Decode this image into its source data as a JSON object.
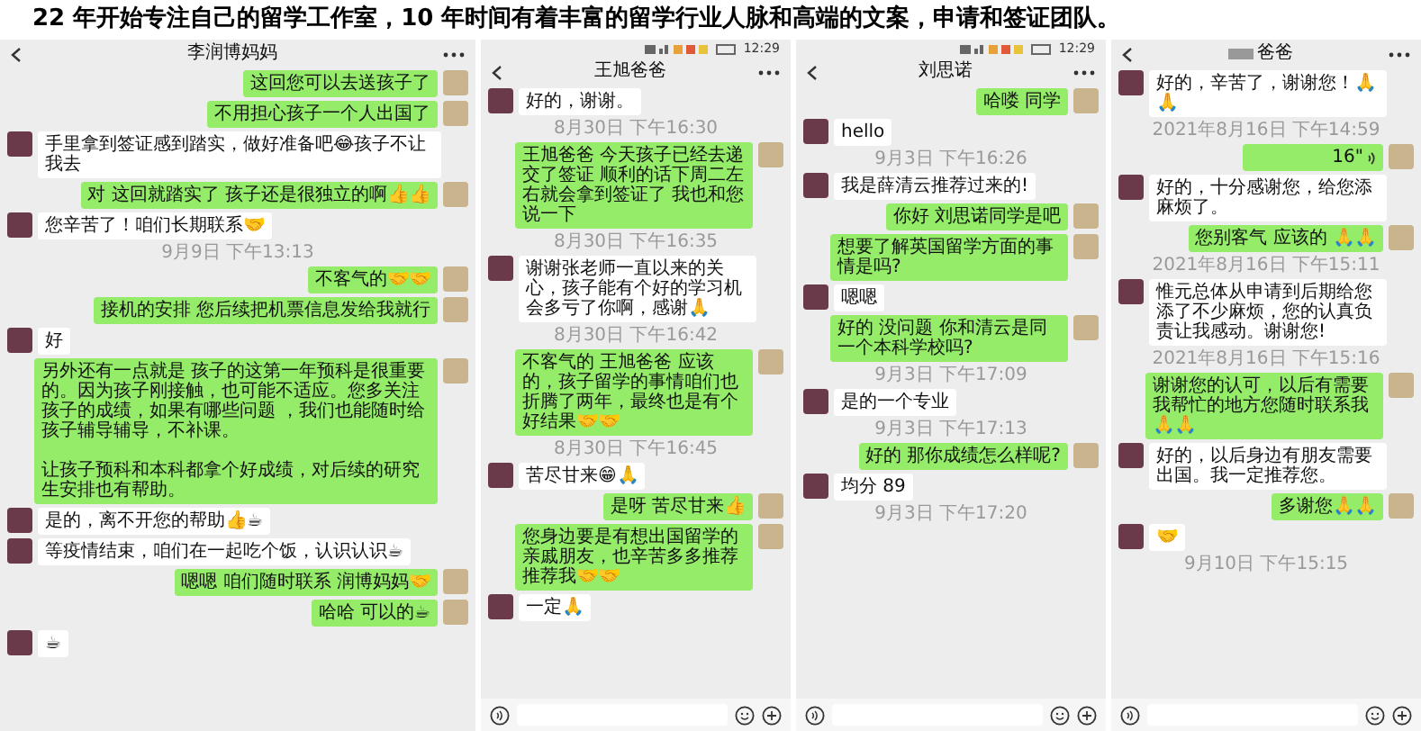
{
  "heading": "22 年开始专注自己的留学工作室，10 年时间有着丰富的留学行业人脉和高端的文案，申请和签证团队。",
  "chats": [
    {
      "title": "李润博妈妈",
      "input_bar": false,
      "messages": [
        {
          "kind": "text",
          "sent": true,
          "text": "这回您可以去送孩子了"
        },
        {
          "kind": "text",
          "sent": true,
          "text": "不用担心孩子一个人出国了"
        },
        {
          "kind": "text",
          "sent": false,
          "text": "手里拿到签证感到踏实，做好准备吧😂孩子不让我去"
        },
        {
          "kind": "text",
          "sent": true,
          "text": "对 这回就踏实了 孩子还是很独立的啊👍👍"
        },
        {
          "kind": "text",
          "sent": false,
          "text": "您辛苦了！咱们长期联系🤝"
        },
        {
          "kind": "time",
          "text": "9月9日 下午13:13"
        },
        {
          "kind": "text",
          "sent": true,
          "text": "不客气的🤝🤝"
        },
        {
          "kind": "text",
          "sent": true,
          "text": "接机的安排 您后续把机票信息发给我就行"
        },
        {
          "kind": "text",
          "sent": false,
          "text": "好"
        },
        {
          "kind": "text",
          "sent": true,
          "paragraphs": [
            "另外还有一点就是 孩子的这第一年预科是很重要的。因为孩子刚接触，也可能不适应。您多关注孩子的成绩，如果有哪些问题 ，我们也能随时给孩子辅导辅导，不补课。",
            "让孩子预科和本科都拿个好成绩，对后续的研究生安排也有帮助。"
          ]
        },
        {
          "kind": "text",
          "sent": false,
          "text": "是的，离不开您的帮助👍☕"
        },
        {
          "kind": "text",
          "sent": false,
          "text": "等疫情结束，咱们在一起吃个饭，认识认识☕"
        },
        {
          "kind": "text",
          "sent": true,
          "text": "嗯嗯 咱们随时联系 润博妈妈🤝"
        },
        {
          "kind": "text",
          "sent": true,
          "text": "哈哈 可以的☕"
        },
        {
          "kind": "text",
          "sent": false,
          "text": "☕"
        }
      ]
    },
    {
      "title": "王旭爸爸",
      "status_time": "12:29",
      "input_bar": true,
      "messages": [
        {
          "kind": "text",
          "sent": false,
          "text": "好的，谢谢。"
        },
        {
          "kind": "time",
          "text": "8月30日 下午16:30"
        },
        {
          "kind": "text",
          "sent": true,
          "text": "王旭爸爸 今天孩子已经去递交了签证 顺利的话下周二左右就会拿到签证了 我也和您说一下"
        },
        {
          "kind": "time",
          "text": "8月30日 下午16:35"
        },
        {
          "kind": "text",
          "sent": false,
          "text": "谢谢张老师一直以来的关心，孩子能有个好的学习机会多亏了你啊，感谢🙏"
        },
        {
          "kind": "time",
          "text": "8月30日 下午16:42"
        },
        {
          "kind": "text",
          "sent": true,
          "text": "不客气的 王旭爸爸 应该的，孩子留学的事情咱们也折腾了两年，最终也是有个好结果🤝🤝"
        },
        {
          "kind": "time",
          "text": "8月30日 下午16:45"
        },
        {
          "kind": "text",
          "sent": false,
          "text": "苦尽甘来😁🙏"
        },
        {
          "kind": "text",
          "sent": true,
          "text": "是呀 苦尽甘来👍"
        },
        {
          "kind": "text",
          "sent": true,
          "text": "您身边要是有想出国留学的亲戚朋友，也辛苦多多推荐推荐我🤝🤝"
        },
        {
          "kind": "text",
          "sent": false,
          "text": "一定🙏"
        }
      ]
    },
    {
      "title": "刘思诺",
      "status_time": "12:29",
      "input_bar": true,
      "messages": [
        {
          "kind": "text",
          "sent": true,
          "text": "哈喽 同学"
        },
        {
          "kind": "text",
          "sent": false,
          "text": "hello"
        },
        {
          "kind": "time",
          "text": "9月3日 下午16:26"
        },
        {
          "kind": "text",
          "sent": false,
          "text": "我是薛清云推荐过来的!"
        },
        {
          "kind": "text",
          "sent": true,
          "text": "你好 刘思诺同学是吧"
        },
        {
          "kind": "text",
          "sent": true,
          "text": "想要了解英国留学方面的事情是吗?"
        },
        {
          "kind": "text",
          "sent": false,
          "text": "嗯嗯"
        },
        {
          "kind": "text",
          "sent": true,
          "text": "好的 没问题 你和清云是同一个本科学校吗?"
        },
        {
          "kind": "time",
          "text": "9月3日 下午17:09"
        },
        {
          "kind": "text",
          "sent": false,
          "text": "是的一个专业"
        },
        {
          "kind": "time",
          "text": "9月3日 下午17:13"
        },
        {
          "kind": "text",
          "sent": true,
          "text": "好的 那你成绩怎么样呢?"
        },
        {
          "kind": "text",
          "sent": false,
          "text": "均分 89"
        },
        {
          "kind": "time",
          "text": "9月3日 下午17:20"
        }
      ]
    },
    {
      "title": "爸爸",
      "title_blurred": true,
      "input_bar": true,
      "messages": [
        {
          "kind": "text",
          "sent": false,
          "text": "好的，辛苦了，谢谢您！🙏🙏"
        },
        {
          "kind": "time",
          "text": "2021年8月16日 下午14:59"
        },
        {
          "kind": "voice",
          "sent": true,
          "text": "16\""
        },
        {
          "kind": "text",
          "sent": false,
          "text": "好的，十分感谢您，给您添麻烦了。"
        },
        {
          "kind": "text",
          "sent": true,
          "text": "您别客气 应该的 🙏🙏"
        },
        {
          "kind": "time",
          "text": "2021年8月16日 下午15:11"
        },
        {
          "kind": "text",
          "sent": false,
          "text": "惟元总体从申请到后期给您添了不少麻烦，您的认真负责让我感动。谢谢您!"
        },
        {
          "kind": "time",
          "text": "2021年8月16日 下午15:16"
        },
        {
          "kind": "text",
          "sent": true,
          "text": "谢谢您的认可，以后有需要我帮忙的地方您随时联系我🙏🙏"
        },
        {
          "kind": "text",
          "sent": false,
          "text": "好的，以后身边有朋友需要出国。我一定推荐您。"
        },
        {
          "kind": "text",
          "sent": true,
          "text": "多谢您🙏🙏"
        },
        {
          "kind": "text",
          "sent": false,
          "text": "🤝"
        },
        {
          "kind": "time",
          "text": "9月10日 下午15:15"
        }
      ]
    }
  ]
}
